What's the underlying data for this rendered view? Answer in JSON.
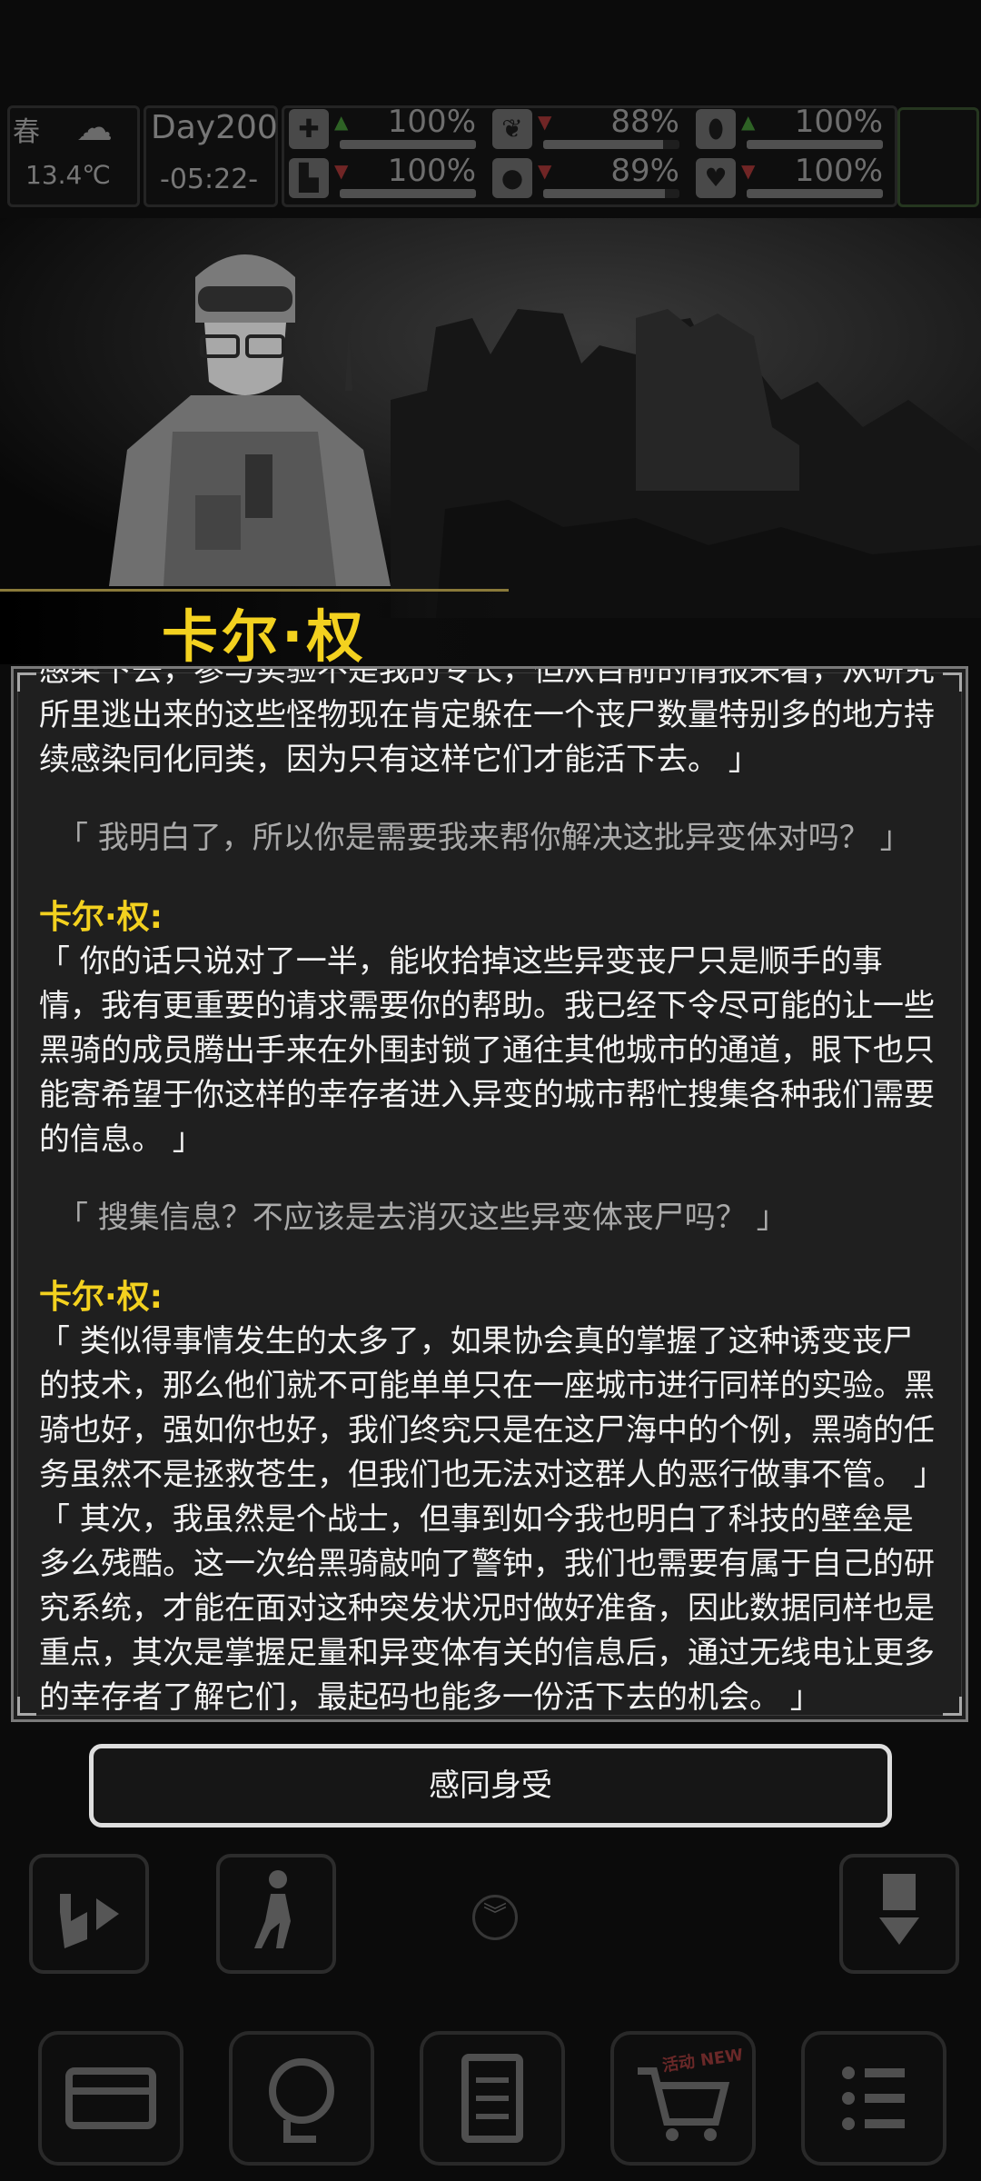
{
  "hud": {
    "season": "春",
    "temperature": "13.4℃",
    "day": "Day200",
    "time": "-05:22-",
    "stats": [
      {
        "icon": "medkit-icon",
        "glyph": "✚",
        "value": "100%",
        "level": 1.0,
        "trend": "up"
      },
      {
        "icon": "stomach-icon",
        "glyph": "❦",
        "value": "88%",
        "level": 0.88,
        "trend": "down"
      },
      {
        "icon": "pill-icon",
        "glyph": "⬮",
        "value": "100%",
        "level": 1.0,
        "trend": "up"
      },
      {
        "icon": "boot-icon",
        "glyph": "▙",
        "value": "100%",
        "level": 1.0,
        "trend": "down"
      },
      {
        "icon": "water-drop-icon",
        "glyph": "●",
        "value": "89%",
        "level": 0.89,
        "trend": "down"
      },
      {
        "icon": "heart-icon",
        "glyph": "♥",
        "value": "100%",
        "level": 1.0,
        "trend": "down"
      }
    ]
  },
  "dialog": {
    "speaker_name": "卡尔·权",
    "p1": "感染下去，参与实验不是我的专长，但从目前的情报来看，从研究所里逃出来的这些怪物现在肯定躲在一个丧尸数量特别多的地方持续感染同化同类，因为只有这样它们才能活下去。 」",
    "r1": "「 我明白了，所以你是需要我来帮你解决这批异变体对吗？ 」",
    "s1": "卡尔·权:",
    "p2": "「 你的话只说对了一半，能收拾掉这些异变丧尸只是顺手的事情，我有更重要的请求需要你的帮助。我已经下令尽可能的让一些黑骑的成员腾出手来在外围封锁了通往其他城市的通道，眼下也只能寄希望于你这样的幸存者进入异变的城市帮忙搜集各种我们需要的信息。 」",
    "r2": "「 搜集信息？不应该是去消灭这些异变体丧尸吗？ 」",
    "s2": "卡尔·权:",
    "p3": "「 类似得事情发生的太多了，如果协会真的掌握了这种诱变丧尸的技术，那么他们就不可能单单只在一座城市进行同样的实验。黑骑也好，强如你也好，我们终究只是在这尸海中的个例，黑骑的任务虽然不是拯救苍生，但我们也无法对这群人的恶行做事不管。 」",
    "p4": "「 其次，我虽然是个战士，但事到如今我也明白了科技的壁垒是多么残酷。这一次给黑骑敲响了警钟，我们也需要有属于自己的研究系统，才能在面对这种突发状况时做好准备，因此数据同样也是重点，其次是掌握足量和异变体有关的信息后，通过无线电让更多的幸存者了解它们，最起码也能多一份活下去的机会。 」"
  },
  "choice_label": "感同身受",
  "badge_text": "活动 NEW",
  "colors": {
    "accent": "#f3d11f",
    "panel": "#1f1f1f",
    "border": "#7a7a7a"
  }
}
